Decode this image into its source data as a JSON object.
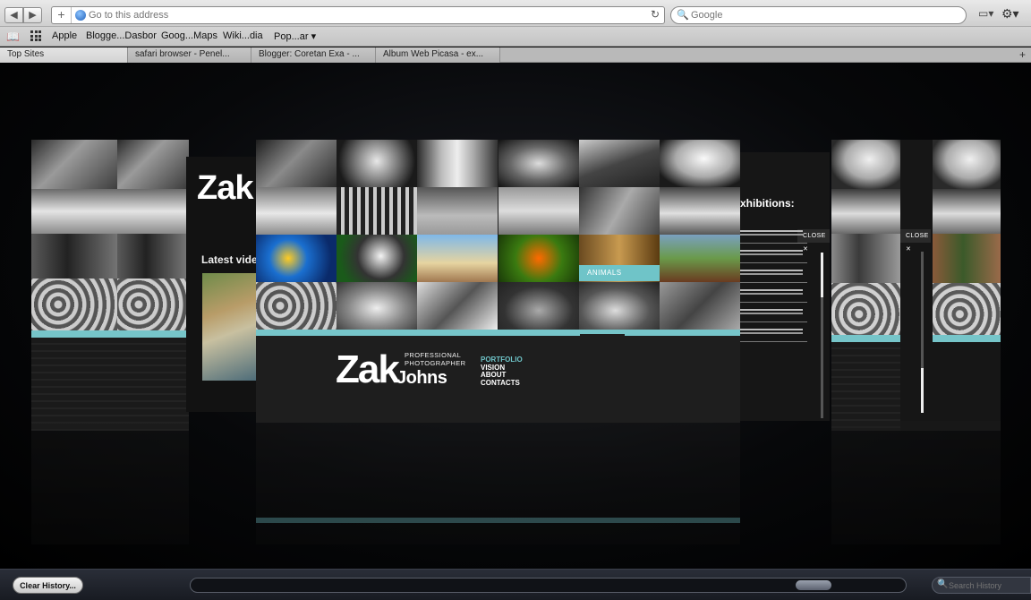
{
  "toolbar": {
    "back_icon": "◀",
    "forward_icon": "▶",
    "add_icon": "+",
    "address_placeholder": "Go to this address",
    "reload_icon": "↻",
    "search_icon": "🔍",
    "search_placeholder": "Google",
    "page_menu_icon": "▭▾",
    "settings_icon": "⚙▾"
  },
  "bookmarks": {
    "reading_list_icon": "📖",
    "items": [
      {
        "label": "Apple"
      },
      {
        "label": "Blogge...Dasbor"
      },
      {
        "label": "Goog...Maps"
      },
      {
        "label": "Wiki...dia"
      },
      {
        "label": "Pop...ar ▾"
      }
    ]
  },
  "tabs": [
    {
      "label": "Top Sites",
      "active": true
    },
    {
      "label": "safari browser - Penel...",
      "active": false
    },
    {
      "label": "Blogger: Coretan Exa - ...",
      "active": false
    },
    {
      "label": "Album Web Picasa - ex...",
      "active": false
    }
  ],
  "tabs_add_icon": "+",
  "site": {
    "logo_zak": "Zak",
    "logo_johns": "Johns",
    "logo_sub1": "PROFESSIONAL",
    "logo_sub2": "PHOTOGRAPHER",
    "highlight_label": "ANIMALS",
    "menu": [
      "PORTFOLIO",
      "VISION",
      "ABOUT",
      "CONTACTS"
    ],
    "latest_video": "Latest video",
    "exhibitions": "xhibitions:",
    "close_label": "CLOSE ✕",
    "left_partial_logo": "Zak"
  },
  "colors": {
    "accent": "#76c5c9"
  },
  "bottombar": {
    "clear_history_label": "Clear History...",
    "search_icon": "🔍",
    "search_placeholder": "Search History"
  }
}
